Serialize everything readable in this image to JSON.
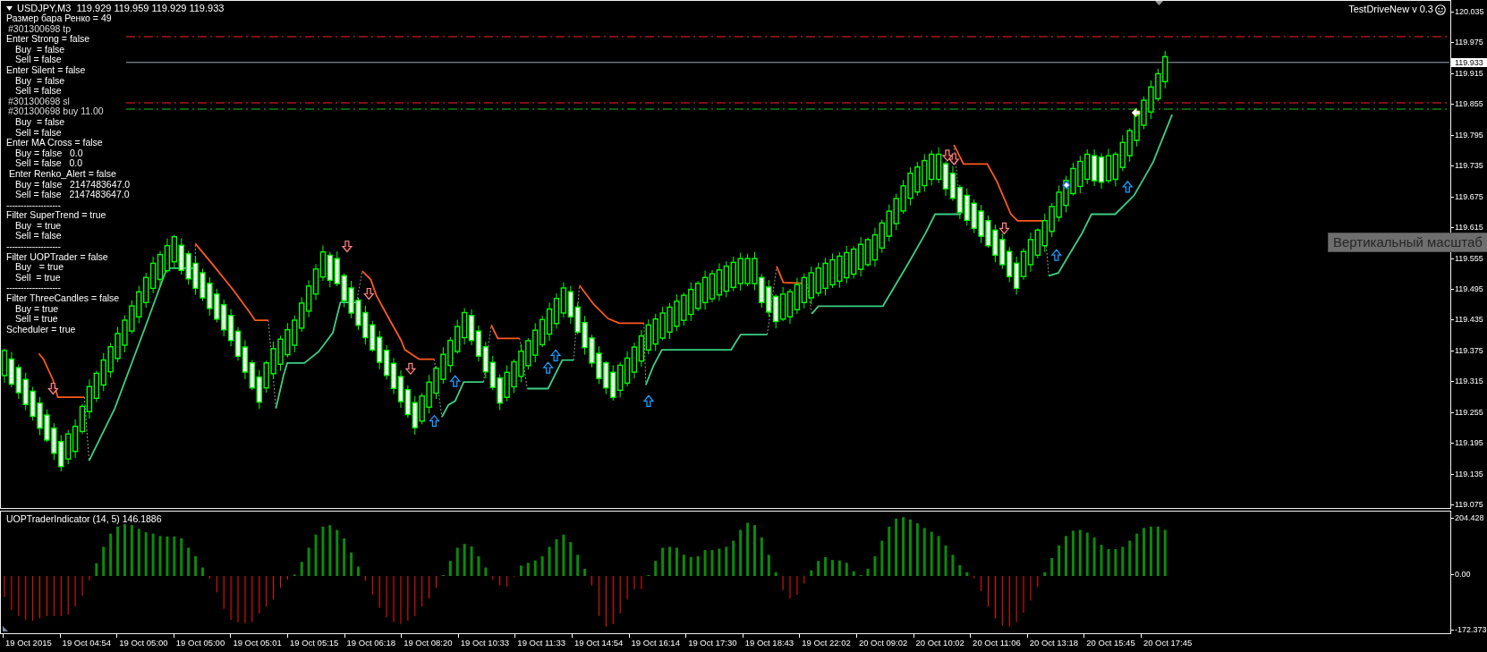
{
  "chart": {
    "symbol_line": "USDJPY,M3  119.929 119.959 119.929 119.933",
    "expert_label": "TestDriveNew v 0.3",
    "status_panel": [
      {
        "kind": "setting",
        "text": "Размер бара Ренко = 49"
      },
      {
        "kind": "order",
        "text": "#301300698 tp"
      },
      {
        "kind": "setting",
        "text": "Enter Strong = false",
        "children": [
          {
            "text": "Buy  = false"
          },
          {
            "text": "Sell = false"
          }
        ]
      },
      {
        "kind": "setting",
        "text": "Enter Silent = false",
        "children": [
          {
            "text": "Buy  = false"
          },
          {
            "text": "Sell = false"
          }
        ]
      },
      {
        "kind": "order",
        "text": "#301300698 sl"
      },
      {
        "kind": "order",
        "text": "#301300698 buy 11.00",
        "children": [
          {
            "text": "Buy  = false"
          },
          {
            "text": "Sell = false"
          }
        ]
      },
      {
        "kind": "setting",
        "text": "Enter MA Cross = false",
        "children": [
          {
            "text": "Buy = false   0.0"
          },
          {
            "text": "Sell = false   0.0"
          }
        ]
      },
      {
        "kind": "setting",
        "text": " Enter Renko_Alert = false",
        "children": [
          {
            "text": "Buy = false   2147483647.0"
          },
          {
            "text": "Sell = false   2147483647.0"
          }
        ]
      },
      {
        "kind": "separator",
        "text": "-------------------"
      },
      {
        "kind": "setting",
        "text": "Filter SuperTrend = true",
        "children": [
          {
            "text": "Buy  = true"
          },
          {
            "text": "Sell = false"
          }
        ]
      },
      {
        "kind": "separator",
        "text": "-------------------"
      },
      {
        "kind": "setting",
        "text": "Filter UOPTrader = false",
        "children": [
          {
            "text": "Buy   = true"
          },
          {
            "text": "Sell  = true"
          }
        ]
      },
      {
        "kind": "separator",
        "text": "-------------------"
      },
      {
        "kind": "setting",
        "text": "Filter ThreeCandles = false",
        "children": [
          {
            "text": "Buy = true"
          },
          {
            "text": "Sell = true"
          }
        ]
      },
      {
        "kind": "setting",
        "text": "Scheduler = true"
      }
    ],
    "price_axis": {
      "labels": [
        "120.035",
        "119.975",
        "119.915",
        "119.855",
        "119.795",
        "119.735",
        "119.675",
        "119.615",
        "119.555",
        "119.495",
        "119.435",
        "119.375",
        "119.315",
        "119.255",
        "119.195",
        "119.135",
        "119.075"
      ],
      "current_price": "119.933"
    },
    "tooltip": "Вертикальный масштаб"
  },
  "indicator": {
    "title": "UOPTraderIndicator (14, 5) 146.1886",
    "axis_labels": [
      "204.428",
      "0.00",
      "-172.373"
    ]
  },
  "time_axis": [
    "19 Oct 2015",
    "19 Oct 04:54",
    "19 Oct 05:00",
    "19 Oct 05:00",
    "19 Oct 05:01",
    "19 Oct 05:15",
    "19 Oct 06:18",
    "19 Oct 08:20",
    "19 Oct 10:33",
    "19 Oct 11:33",
    "19 Oct 14:54",
    "19 Oct 16:14",
    "19 Oct 17:30",
    "19 Oct 18:43",
    "19 Oct 22:02",
    "20 Oct 09:02",
    "20 Oct 10:02",
    "20 Oct 11:06",
    "20 Oct 13:18",
    "20 Oct 15:45",
    "20 Oct 17:45"
  ]
}
